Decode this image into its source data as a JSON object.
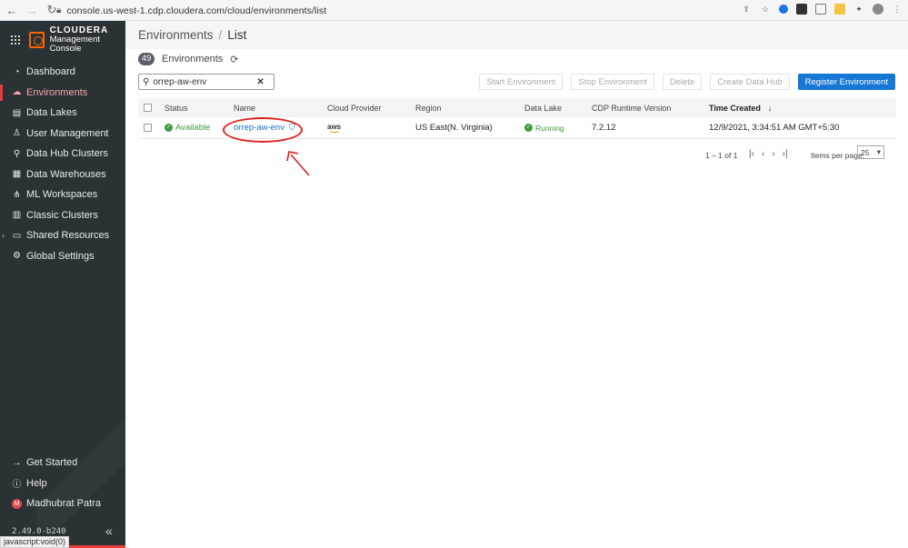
{
  "browser": {
    "url": "console.us-west-1.cdp.cloudera.com/cloud/environments/list"
  },
  "brand": {
    "name": "CLOUDERA",
    "sub": "Management Console"
  },
  "sidebar": {
    "items": [
      {
        "label": "Dashboard",
        "icon": "gauge-icon"
      },
      {
        "label": "Environments",
        "icon": "cloud-icon"
      },
      {
        "label": "Data Lakes",
        "icon": "data-lake-icon"
      },
      {
        "label": "User Management",
        "icon": "user-icon"
      },
      {
        "label": "Data Hub Clusters",
        "icon": "data-hub-icon"
      },
      {
        "label": "Data Warehouses",
        "icon": "warehouse-icon"
      },
      {
        "label": "ML Workspaces",
        "icon": "ml-icon"
      },
      {
        "label": "Classic Clusters",
        "icon": "server-icon"
      },
      {
        "label": "Shared Resources",
        "icon": "folder-icon"
      },
      {
        "label": "Global Settings",
        "icon": "gear-icon"
      }
    ],
    "bottom": [
      {
        "label": "Get Started"
      },
      {
        "label": "Help"
      },
      {
        "label": "Madhubrat Patra",
        "avatar": "M"
      }
    ],
    "version": "2.49.0-b240",
    "status_url": "javascript:void(0)"
  },
  "header": {
    "section": "Environments",
    "separator": "/",
    "page": "List"
  },
  "summary": {
    "count": "49",
    "label": "Environments"
  },
  "search": {
    "value": "orrep-aw-env",
    "clear": "✕"
  },
  "toolbar": {
    "start": "Start Environment",
    "stop": "Stop Environment",
    "delete": "Delete",
    "create_hub": "Create Data Hub",
    "register": "Register Environment"
  },
  "table": {
    "headers": {
      "status": "Status",
      "name": "Name",
      "cloud": "Cloud Provider",
      "region": "Region",
      "datalake": "Data Lake",
      "runtime": "CDP Runtime Version",
      "created": "Time Created"
    },
    "rows": [
      {
        "status": "Available",
        "name": "orrep-aw-env",
        "cloud": "aws",
        "region": "US East(N. Virginia)",
        "datalake": "Running",
        "runtime": "7.2.12",
        "created": "12/9/2021, 3:34:51 AM GMT+5:30"
      }
    ]
  },
  "pagination": {
    "range": "1 – 1 of 1",
    "items_label": "Items per page:",
    "page_size": "25"
  },
  "colors": {
    "sidebar_bg": "#2b3236",
    "accent_red": "#e63c3c",
    "primary_blue": "#1677d4",
    "success_green": "#3d9a3d",
    "annotation_red": "#e02020"
  }
}
